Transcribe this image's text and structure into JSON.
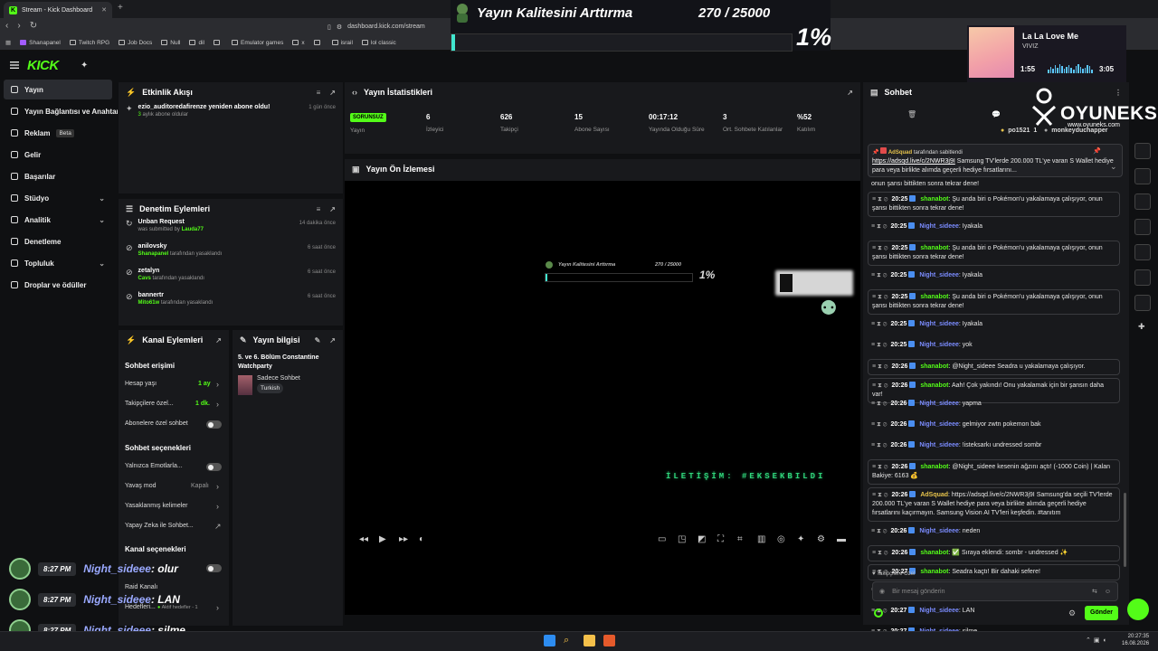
{
  "browser": {
    "tab_title": "Stream - Kick Dashboard",
    "url": "dashboard.kick.com/stream",
    "bookmarks": [
      "Shanapanel",
      "Twitch RPG",
      "Job Docs",
      "Null",
      "dil",
      "",
      "Emulator games",
      "x",
      "",
      "israil",
      "lol classic"
    ]
  },
  "overlay": {
    "goal_title": "Yayın Kalitesini Arttırma",
    "goal_count": "270 / 25000",
    "goal_percent": "1%",
    "goal_progress": 0.0108
  },
  "music": {
    "title": "La La Love Me",
    "artist": "VIVIZ",
    "elapsed": "1:55",
    "duration": "3:05"
  },
  "watermark": {
    "brand": "OYUNEKS",
    "site": "www.oyuneks.com"
  },
  "sidebar": {
    "items": [
      {
        "label": "Yayın",
        "chevron": false
      },
      {
        "label": "Yayın Bağlantısı ve Anahtarı",
        "chevron": false
      },
      {
        "label": "Reklam",
        "badge": "Beta",
        "chevron": false
      },
      {
        "label": "Gelir",
        "chevron": false
      },
      {
        "label": "Başarılar",
        "chevron": false
      },
      {
        "label": "Stüdyo",
        "chevron": true
      },
      {
        "label": "Analitik",
        "chevron": true
      },
      {
        "label": "Denetleme",
        "chevron": false
      },
      {
        "label": "Topluluk",
        "chevron": true
      },
      {
        "label": "Droplar ve ödüller",
        "chevron": false
      }
    ]
  },
  "activity": {
    "title": "Etkinlik Akışı",
    "items": [
      {
        "text": "ezio_auditoredafirenze yeniden abone oldu!",
        "detail_highlight": "3",
        "detail": " aylık abone oldular",
        "time": "1 gün önce"
      }
    ]
  },
  "moderation": {
    "title": "Denetim Eylemleri",
    "items": [
      {
        "user": "Unban Request",
        "detail_pre": "was submitted by ",
        "detail_user": "Lauda77",
        "detail_post": "",
        "time": "14 dakika önce"
      },
      {
        "user": "anilovsky",
        "detail_pre": "",
        "detail_user": "Shanapanel",
        "detail_post": " tarafından yasaklandı",
        "time": "6 saat önce"
      },
      {
        "user": "zetalyn",
        "detail_pre": "",
        "detail_user": "Cavs",
        "detail_post": " tarafından yasaklandı",
        "time": "6 saat önce"
      },
      {
        "user": "bannertr",
        "detail_pre": "",
        "detail_user": "Mito61w",
        "detail_post": " tarafından yasaklandı",
        "time": "6 saat önce"
      }
    ]
  },
  "channel_actions": {
    "title": "Kanal Eylemleri",
    "chat_access": "Sohbet erişimi",
    "account_age_label": "Hesap yaşı",
    "account_age_value": "1 ay",
    "followers_only_label": "Takipçilere özel...",
    "followers_only_value": "1 dk.",
    "subscribers_only_label": "Abonelere özel sohbet",
    "chat_options": "Sohbet seçenekleri",
    "emotes_only_label": "Yalnızca Emotlarla...",
    "slow_mode_label": "Yavaş mod",
    "slow_mode_value": "Kapalı",
    "banned_words_label": "Yasaklanmış kelimeler",
    "ai_chat_label": "Yapay Zeka ile Sohbet...",
    "channel_options": "Kanal seçenekleri",
    "raid_label": "Raid Kanalı",
    "goals_label": "Hedefleri...",
    "goals_value": "Aktif hedefler - 1"
  },
  "stream_info": {
    "title": "Yayın bilgisi",
    "stream_title": "5. ve 6. Bölüm Constantine Watchparty",
    "category": "Sadece Sohbet",
    "tag": "Turkish"
  },
  "stats": {
    "title": "Yayın İstatistikleri",
    "status_badge": "SORUNSUZ",
    "status_label": "Yayın",
    "cells": [
      {
        "value": "6",
        "label": "İzleyici"
      },
      {
        "value": "626",
        "label": "Takipçi"
      },
      {
        "value": "15",
        "label": "Abone Sayısı"
      },
      {
        "value": "00:17:12",
        "label": "Yayında Olduğu Süre"
      },
      {
        "value": "3",
        "label": "Ort. Sohbete Katılanlar"
      },
      {
        "value": "%52",
        "label": "Katılım"
      }
    ]
  },
  "preview": {
    "title": "Yayın Ön İzlemesi",
    "inner_goal_title": "Yayın Kalitesini Arttırma",
    "inner_goal_count": "270 / 25000",
    "inner_percent": "1%",
    "inner_marquee": "İLETİŞİM: #EKSEKBILDI"
  },
  "chat": {
    "title": "Sohbet",
    "leaderboard": [
      {
        "name": "po1521",
        "count": "1"
      },
      {
        "name": "monkeyduchapper",
        "count": ""
      }
    ],
    "pinned_by_user": "AdSquad",
    "pinned_by_suffix": " tarafından sabitlendi",
    "pinned_link": "https://adsqd.live/c/2NWR3j9I",
    "pinned_text": " Samsung TV'lerde 200.000 TL'ye varan S Wallet hediye para veya birlikte alımda geçerli hediye fırsatlarını...",
    "cut_text": "onun şansı bittikten sonra tekrar dene!",
    "messages": [
      {
        "time": "20:25",
        "user": "shanabot",
        "text": ": Şu anda biri o Pokémon'u yakalamaya çalışıyor, onun şansı bittikten sonra tekrar dene!",
        "color": "g",
        "boxed": true
      },
      {
        "time": "20:25",
        "user": "Night_sideee",
        "text": ": Iyakala",
        "color": "b",
        "boxed": false
      },
      {
        "time": "20:25",
        "user": "shanabot",
        "text": ": Şu anda biri o Pokémon'u yakalamaya çalışıyor, onun şansı bittikten sonra tekrar dene!",
        "color": "g",
        "boxed": true
      },
      {
        "time": "20:25",
        "user": "Night_sideee",
        "text": ": Iyakala",
        "color": "b",
        "boxed": false
      },
      {
        "time": "20:25",
        "user": "shanabot",
        "text": ": Şu anda biri o Pokémon'u yakalamaya çalışıyor, onun şansı bittikten sonra tekrar dene!",
        "color": "g",
        "boxed": true
      },
      {
        "time": "20:25",
        "user": "Night_sideee",
        "text": ": Iyakala",
        "color": "b",
        "boxed": false
      },
      {
        "time": "20:25",
        "user": "Night_sideee",
        "text": ": yok",
        "color": "b",
        "boxed": false
      },
      {
        "time": "20:26",
        "user": "shanabot",
        "text": ": @Night_sideee Seadra u yakalamaya çalışıyor.",
        "color": "g",
        "boxed": true
      },
      {
        "time": "20:26",
        "user": "shanabot",
        "text": ": Aah! Çok yakındı! Onu yakalamak için bir şansın daha var!",
        "color": "g",
        "boxed": true
      },
      {
        "time": "20:26",
        "user": "Night_sideee",
        "text": ": yapma",
        "color": "b",
        "boxed": false
      },
      {
        "time": "20:26",
        "user": "Night_sideee",
        "text": ": gelmiyor zwtn pokemon bak",
        "color": "b",
        "boxed": false
      },
      {
        "time": "20:26",
        "user": "Night_sideee",
        "text": ": !isteksarkı undressed sombr",
        "color": "b",
        "boxed": false
      },
      {
        "time": "20:26",
        "user": "shanabot",
        "text": ": @Night_sideee kesenin ağzını açtı! (-1000 Coin) | Kalan Bakiye: 6163 💰",
        "color": "g",
        "boxed": true
      },
      {
        "time": "20:26",
        "user": "AdSquad",
        "text": ": https://adsqd.live/c/2NWR3j9I Samsung'da seçili TV'lerde 200.000 TL'ye varan S Wallet hediye para veya birlikte alımda geçerli hediye fırsatlarını kaçırmayın. Samsung Vision AI TV'leri keşfedin. #tanıtım",
        "color": "y",
        "boxed": true
      },
      {
        "time": "20:26",
        "user": "Night_sideee",
        "text": ": neden",
        "color": "b",
        "boxed": false
      },
      {
        "time": "20:26",
        "user": "shanabot",
        "text": ": ✅ Sıraya eklendi: sombr - undressed ✨",
        "color": "g",
        "boxed": true
      },
      {
        "time": "20:27",
        "user": "shanabot",
        "text": ": Seadra kaçtı! Bir dahaki sefere!",
        "color": "g",
        "boxed": true
      },
      {
        "time": "20:27",
        "user": "Night_sideee",
        "text": ": olur",
        "color": "b",
        "boxed": false
      },
      {
        "time": "20:27",
        "user": "Night_sideee",
        "text": ": LAN",
        "color": "b",
        "boxed": false
      },
      {
        "time": "20:27",
        "user": "Night_sideee",
        "text": ": silme",
        "color": "b",
        "boxed": false
      }
    ],
    "followers_only_notice": "Takipçilere Özel",
    "input_placeholder": "Bir mesaj gönderin",
    "send_label": "Gönder"
  },
  "overlay_chat": [
    {
      "time": "8:27 PM",
      "user": "Night_sideee",
      "text": ": olur"
    },
    {
      "time": "8:27 PM",
      "user": "Night_sideee",
      "text": ": LAN"
    },
    {
      "time": "8:27 PM",
      "user": "Night_sideee",
      "text": ": silme"
    }
  ],
  "taskbar": {
    "time": "20:27:35",
    "date": "16.08.2026"
  }
}
